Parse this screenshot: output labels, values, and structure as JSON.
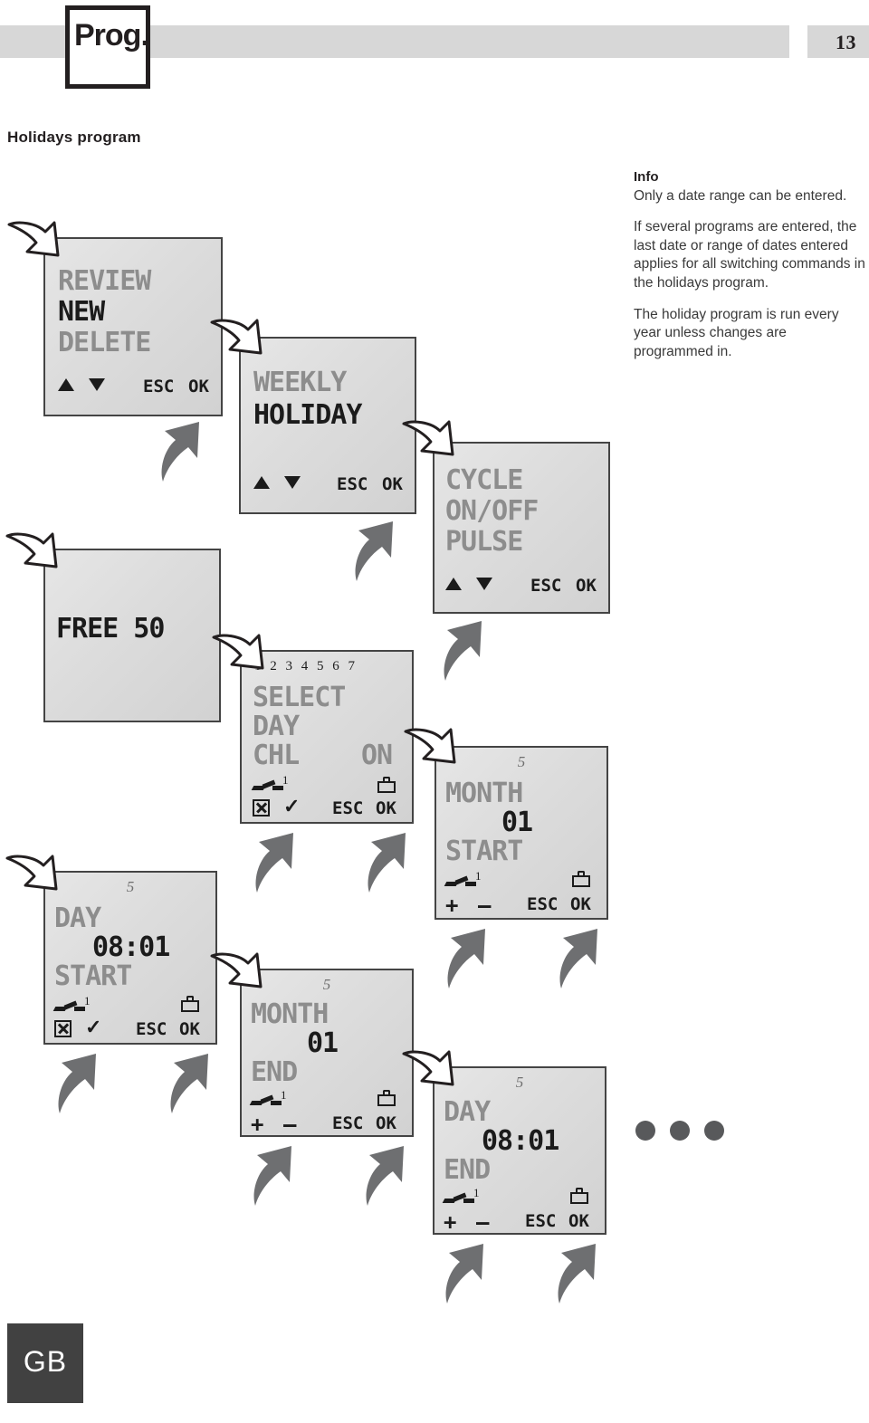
{
  "header": {
    "prog_label": "Prog.",
    "page_number": "13"
  },
  "section_title": "Holidays program",
  "info": {
    "heading": "Info",
    "paragraph1": "Only a date range can be entered.",
    "paragraph2": "If several programs are entered, the last date or range of dates entered applies for all switching commands in the holidays program.",
    "paragraph3": "The holiday program is run every year unless changes are programmed in."
  },
  "footer": {
    "language_badge": "GB"
  },
  "labels": {
    "esc": "ESC",
    "ok": "OK",
    "plus": "+",
    "minus": "–",
    "tick": "✓",
    "up_arrow": "△",
    "down_arrow": "▽",
    "relay_channel": "1",
    "day_numbers": "1 2 3 4 5 6 7",
    "step_number": "5"
  },
  "screens": [
    {
      "id": "screen-menu",
      "line1": "REVIEW",
      "line1_state": "dim",
      "line2": "NEW",
      "line2_state": "on",
      "line3": "DELETE",
      "line3_state": "dim",
      "buttons": [
        "up",
        "down",
        "esc",
        "ok"
      ]
    },
    {
      "id": "screen-program-type",
      "line1": "WEEKLY",
      "line1_state": "dim",
      "line2": "HOLIDAY",
      "line2_state": "on",
      "buttons": [
        "up",
        "down",
        "esc",
        "ok"
      ]
    },
    {
      "id": "screen-switch-type",
      "line1": "CYCLE",
      "line1_state": "dim",
      "line2": "ON/OFF",
      "line2_state": "dim",
      "line3": "PULSE",
      "line3_state": "dim",
      "buttons": [
        "up",
        "down",
        "esc",
        "ok"
      ]
    },
    {
      "id": "screen-free-memory",
      "line1": "FREE 50",
      "line1_state": "on",
      "buttons": []
    },
    {
      "id": "screen-select-day",
      "header_numbers": "1 2 3 4 5 6 7",
      "line1": "SELECT",
      "line1_state": "dim",
      "line2": "DAY",
      "line2_state": "dim",
      "line3": "CHL",
      "line3_state": "dim",
      "line3_right": "ON",
      "line3_right_state": "dim",
      "buttons": [
        "boxed-x",
        "tick",
        "esc",
        "ok"
      ],
      "icons": [
        "relay-1",
        "briefcase"
      ]
    },
    {
      "id": "screen-month-start",
      "step": "5",
      "line1": "MONTH",
      "line1_state": "dim",
      "value": "01",
      "value_state": "on",
      "line3": "START",
      "line3_state": "dim",
      "buttons": [
        "plus",
        "minus",
        "esc",
        "ok"
      ],
      "icons": [
        "relay-1",
        "briefcase"
      ]
    },
    {
      "id": "screen-day-start",
      "step": "5",
      "line1": "DAY",
      "line1_state": "dim",
      "value": "08:01",
      "value_state": "on",
      "line3": "START",
      "line3_state": "dim",
      "buttons": [
        "boxed-x",
        "tick",
        "esc",
        "ok"
      ],
      "icons": [
        "relay-1",
        "briefcase"
      ]
    },
    {
      "id": "screen-month-end",
      "step": "5",
      "line1": "MONTH",
      "line1_state": "dim",
      "value": "01",
      "value_state": "on",
      "line3": "END",
      "line3_state": "dim",
      "buttons": [
        "plus",
        "minus",
        "esc",
        "ok"
      ],
      "icons": [
        "relay-1",
        "briefcase"
      ]
    },
    {
      "id": "screen-day-end",
      "step": "5",
      "line1": "DAY",
      "line1_state": "dim",
      "value": "08:01",
      "value_state": "on",
      "line3": "END",
      "line3_state": "dim",
      "buttons": [
        "plus",
        "minus",
        "esc",
        "ok"
      ],
      "icons": [
        "relay-1",
        "briefcase"
      ]
    }
  ],
  "colors": {
    "header_grey": "#d7d7d7",
    "lcd_grey": "#dcdcdc",
    "segment_on": "#1b1b1b",
    "segment_dim": "#8d8d8d",
    "arrow_grey": "#6e6f71",
    "badge_dark": "#414141"
  }
}
